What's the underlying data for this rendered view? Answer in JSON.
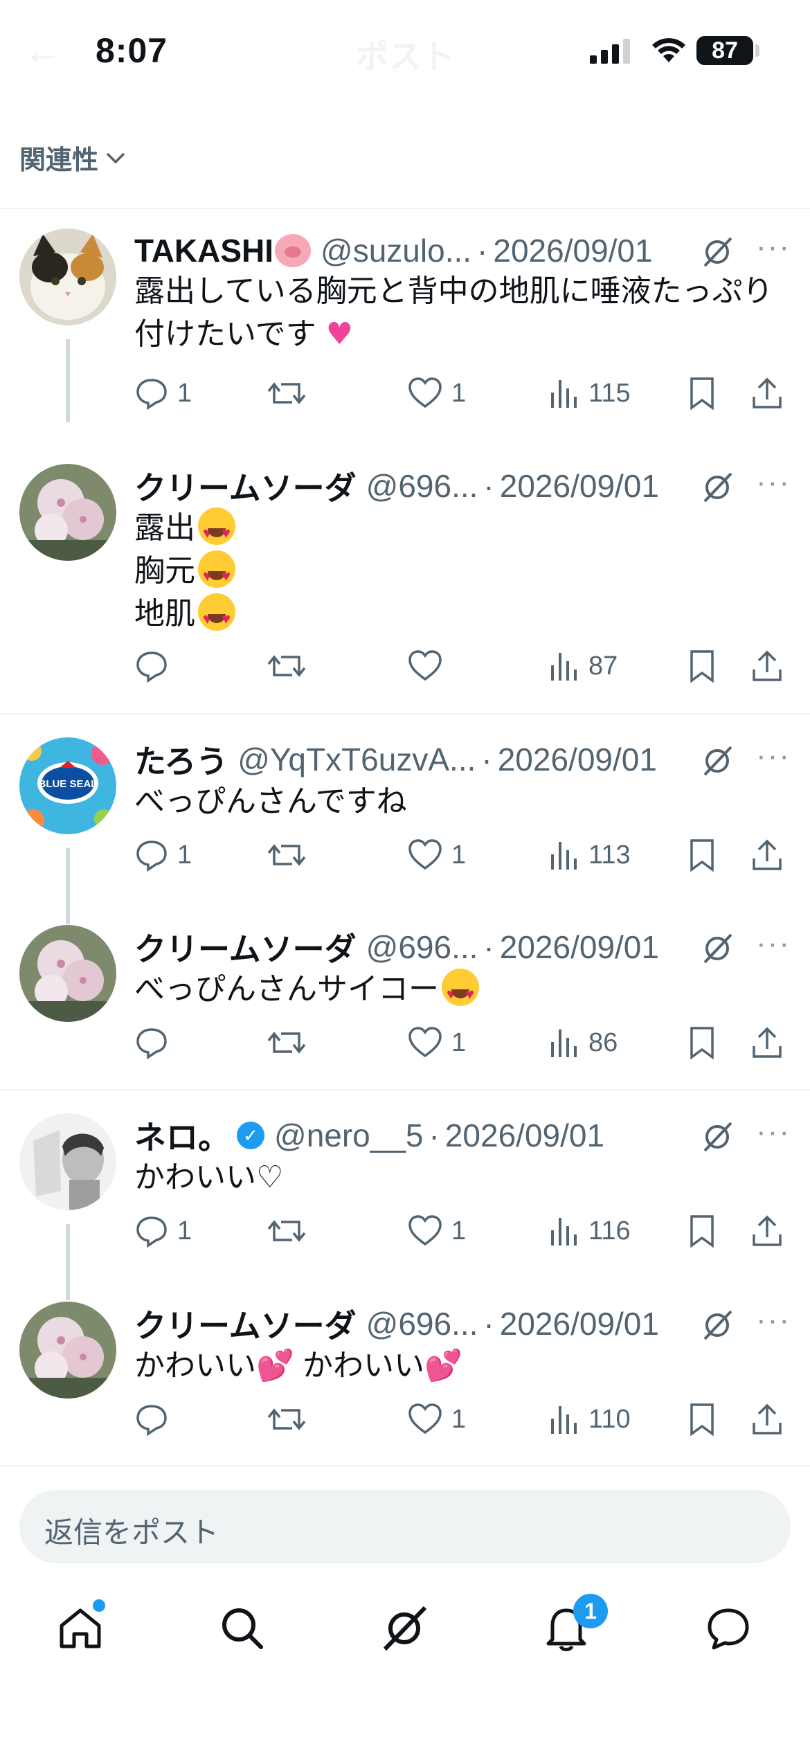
{
  "status_bar": {
    "time": "8:07",
    "battery": "87"
  },
  "header": {
    "title": "ポスト"
  },
  "sort": {
    "label": "関連性"
  },
  "posts": [
    {
      "name": "TAKASHI",
      "handle": "@suzulo...",
      "date": "2026/09/01",
      "body": [
        "露出している胸元と背中の地肌に唾液たっぷり",
        "付けたいです"
      ],
      "replies": "1",
      "likes": "1",
      "views": "115"
    },
    {
      "name": "クリームソーダ",
      "handle": "@696...",
      "date": "2026/09/01",
      "body": [
        "露出",
        "胸元",
        "地肌"
      ],
      "replies": "",
      "likes": "",
      "views": "87"
    },
    {
      "name": "たろう",
      "handle": "@YqTxT6uzvA...",
      "date": "2026/09/01",
      "body": [
        "べっぴんさんですね"
      ],
      "replies": "1",
      "likes": "1",
      "views": "113"
    },
    {
      "name": "クリームソーダ",
      "handle": "@696...",
      "date": "2026/09/01",
      "body": [
        "べっぴんさんサイコー"
      ],
      "replies": "",
      "likes": "1",
      "views": "86"
    },
    {
      "name": "ネロ。",
      "handle": "@nero__5",
      "date": "2026/09/01",
      "body": [
        "かわいい♡"
      ],
      "replies": "1",
      "likes": "1",
      "views": "116"
    },
    {
      "name": "クリームソーダ",
      "handle": "@696...",
      "date": "2026/09/01",
      "body": [
        "かわいい",
        "かわいい"
      ],
      "replies": "",
      "likes": "1",
      "views": "110"
    }
  ],
  "reply": {
    "placeholder": "返信をポスト"
  },
  "tabbar": {
    "notifications_badge": "1"
  },
  "colors": {
    "accent": "#1d9bf0",
    "text": "#0f1419",
    "secondary": "#536471",
    "pink_heart": "#f0449a"
  },
  "icons": [
    "back-icon",
    "signal-icon",
    "wifi-icon",
    "chevron-down-icon",
    "grok-icon",
    "more-icon",
    "reply-icon",
    "repost-icon",
    "like-icon",
    "views-icon",
    "bookmark-icon",
    "share-icon",
    "home-icon",
    "search-icon",
    "grok-tab-icon",
    "bell-icon",
    "messages-icon"
  ]
}
